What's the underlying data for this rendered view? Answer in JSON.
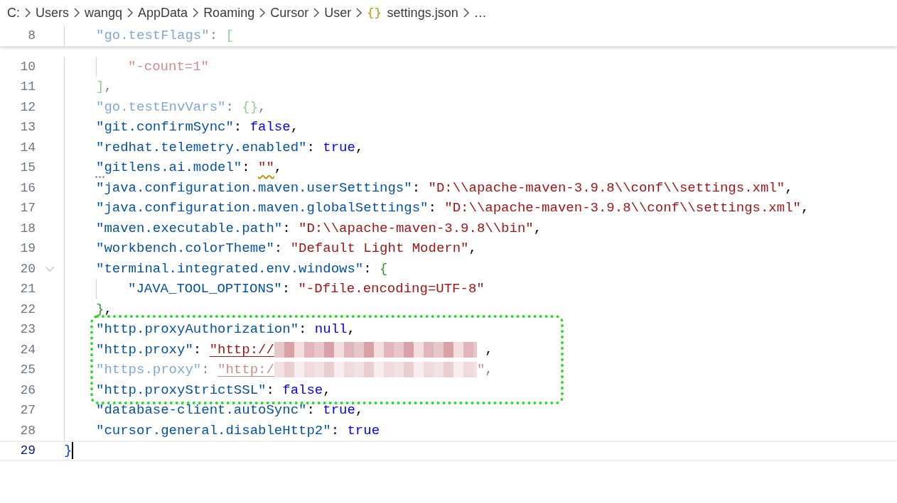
{
  "breadcrumb": [
    {
      "label": "C:"
    },
    {
      "label": "Users"
    },
    {
      "label": "wangq"
    },
    {
      "label": "AppData"
    },
    {
      "label": "Roaming"
    },
    {
      "label": "Cursor"
    },
    {
      "label": "User"
    },
    {
      "label": "settings.json",
      "icon": "{}"
    },
    {
      "label": "…"
    }
  ],
  "sticky_header": {
    "number": "8",
    "dimmed": true,
    "tokens": [
      {
        "kind": "key",
        "text": "\"go.testFlags\""
      },
      {
        "kind": "punct",
        "text": ": "
      },
      {
        "kind": "bracket",
        "text": "["
      }
    ]
  },
  "lines": [
    {
      "kind": "tail",
      "children": [
        {
          "kind": "line",
          "number": "10",
          "dimmed": true,
          "tokens": [
            {
              "kind": "string",
              "text": "\"-count=1\""
            }
          ]
        }
      ]
    },
    {
      "kind": "line",
      "number": "11",
      "dimmed": true,
      "tokens": [
        {
          "kind": "bracket",
          "text": "]"
        },
        {
          "kind": "punct",
          "text": ","
        }
      ]
    },
    {
      "kind": "line",
      "number": "12",
      "dimmed": true,
      "tokens": [
        {
          "kind": "key",
          "text": "\"go.testEnvVars\""
        },
        {
          "kind": "punct",
          "text": ": "
        },
        {
          "kind": "bracket",
          "text": "{}"
        },
        {
          "kind": "punct",
          "text": ","
        }
      ]
    },
    {
      "kind": "line",
      "number": "13",
      "tokens": [
        {
          "kind": "key",
          "text": "\"git.confirmSync\""
        },
        {
          "kind": "punct",
          "text": ": "
        },
        {
          "kind": "keyword",
          "text": "false"
        },
        {
          "kind": "punct",
          "text": ","
        }
      ]
    },
    {
      "kind": "line",
      "number": "14",
      "tokens": [
        {
          "kind": "key",
          "text": "\"redhat.telemetry.enabled\""
        },
        {
          "kind": "punct",
          "text": ": "
        },
        {
          "kind": "keyword",
          "text": "true"
        },
        {
          "kind": "punct",
          "text": ","
        }
      ]
    },
    {
      "kind": "line",
      "number": "15",
      "hint": true,
      "tokens": [
        {
          "kind": "key",
          "text": "\"gitlens.ai.model\""
        },
        {
          "kind": "punct",
          "text": ": "
        },
        {
          "kind": "string",
          "text": "\"\"",
          "squiggle": true
        },
        {
          "kind": "punct",
          "text": ","
        }
      ]
    },
    {
      "kind": "line",
      "number": "16",
      "tokens": [
        {
          "kind": "key",
          "text": "\"java.configuration.maven.userSettings\""
        },
        {
          "kind": "punct",
          "text": ": "
        },
        {
          "kind": "string",
          "text": "\"D:\\\\apache-maven-3.9.8\\\\conf\\\\settings.xml\""
        },
        {
          "kind": "punct",
          "text": ","
        }
      ]
    },
    {
      "kind": "line",
      "number": "17",
      "tokens": [
        {
          "kind": "key",
          "text": "\"java.configuration.maven.globalSettings\""
        },
        {
          "kind": "punct",
          "text": ": "
        },
        {
          "kind": "string",
          "text": "\"D:\\\\apache-maven-3.9.8\\\\conf\\\\settings.xml\""
        },
        {
          "kind": "punct",
          "text": ","
        }
      ]
    },
    {
      "kind": "line",
      "number": "18",
      "tokens": [
        {
          "kind": "key",
          "text": "\"maven.executable.path\""
        },
        {
          "kind": "punct",
          "text": ": "
        },
        {
          "kind": "string",
          "text": "\"D:\\\\apache-maven-3.9.8\\\\bin\""
        },
        {
          "kind": "punct",
          "text": ","
        }
      ]
    },
    {
      "kind": "line",
      "number": "19",
      "tokens": [
        {
          "kind": "key",
          "text": "\"workbench.colorTheme\""
        },
        {
          "kind": "punct",
          "text": ": "
        },
        {
          "kind": "string",
          "text": "\"Default Light Modern\""
        },
        {
          "kind": "punct",
          "text": ","
        }
      ]
    },
    {
      "kind": "line",
      "number": "20",
      "fold": {
        "expanded": true
      },
      "tokens": [
        {
          "kind": "key",
          "text": "\"terminal.integrated.env.windows\""
        },
        {
          "kind": "punct",
          "text": ": "
        },
        {
          "kind": "bracket",
          "text": "{"
        }
      ],
      "children": [
        {
          "kind": "line",
          "number": "21",
          "tokens": [
            {
              "kind": "key",
              "text": "\"JAVA_TOOL_OPTIONS\""
            },
            {
              "kind": "punct",
              "text": ": "
            },
            {
              "kind": "string",
              "text": "\"-Dfile.encoding=UTF-8\""
            }
          ]
        }
      ]
    },
    {
      "kind": "line",
      "number": "22",
      "tokens": [
        {
          "kind": "bracket",
          "text": "}"
        },
        {
          "kind": "punct",
          "text": ","
        }
      ]
    },
    {
      "kind": "highlight",
      "children": [
        {
          "kind": "line",
          "number": "23",
          "tokens": [
            {
              "kind": "key",
              "text": "\"http.proxyAuthorization\""
            },
            {
              "kind": "punct",
              "text": ": "
            },
            {
              "kind": "keyword",
              "text": "null"
            },
            {
              "kind": "punct",
              "text": ","
            }
          ]
        },
        {
          "kind": "line",
          "number": "24",
          "tokens": [
            {
              "kind": "key",
              "text": "\"http.proxy\""
            },
            {
              "kind": "punct",
              "text": ": "
            },
            {
              "kind": "string",
              "text": "\"http://",
              "link": true
            },
            {
              "kind": "redacted"
            },
            {
              "kind": "punct",
              "text": " ,"
            }
          ]
        },
        {
          "kind": "line",
          "number": "25",
          "dimmed": true,
          "tokens": [
            {
              "kind": "key",
              "text": "\"https.proxy\""
            },
            {
              "kind": "punct",
              "text": ": "
            },
            {
              "kind": "string",
              "text": "\"http:/",
              "link": true
            },
            {
              "kind": "redacted"
            },
            {
              "kind": "string",
              "text": "\""
            },
            {
              "kind": "punct",
              "text": ","
            }
          ]
        },
        {
          "kind": "line",
          "number": "26",
          "tokens": [
            {
              "kind": "key",
              "text": "\"http.proxyStrictSSL\""
            },
            {
              "kind": "punct",
              "text": ": "
            },
            {
              "kind": "keyword",
              "text": "false"
            },
            {
              "kind": "punct",
              "text": ","
            }
          ]
        }
      ]
    },
    {
      "kind": "line",
      "number": "27",
      "tokens": [
        {
          "kind": "key",
          "text": "\"database-client.autoSync\""
        },
        {
          "kind": "punct",
          "text": ": "
        },
        {
          "kind": "keyword",
          "text": "true"
        },
        {
          "kind": "punct",
          "text": ","
        }
      ]
    },
    {
      "kind": "line",
      "number": "28",
      "tokens": [
        {
          "kind": "key",
          "text": "\"cursor.general.disableHttp2\""
        },
        {
          "kind": "punct",
          "text": ": "
        },
        {
          "kind": "keyword",
          "text": "true"
        }
      ]
    }
  ],
  "closing": {
    "number": "29",
    "current": true,
    "tokens": [
      {
        "kind": "brace",
        "text": "}"
      }
    ]
  }
}
